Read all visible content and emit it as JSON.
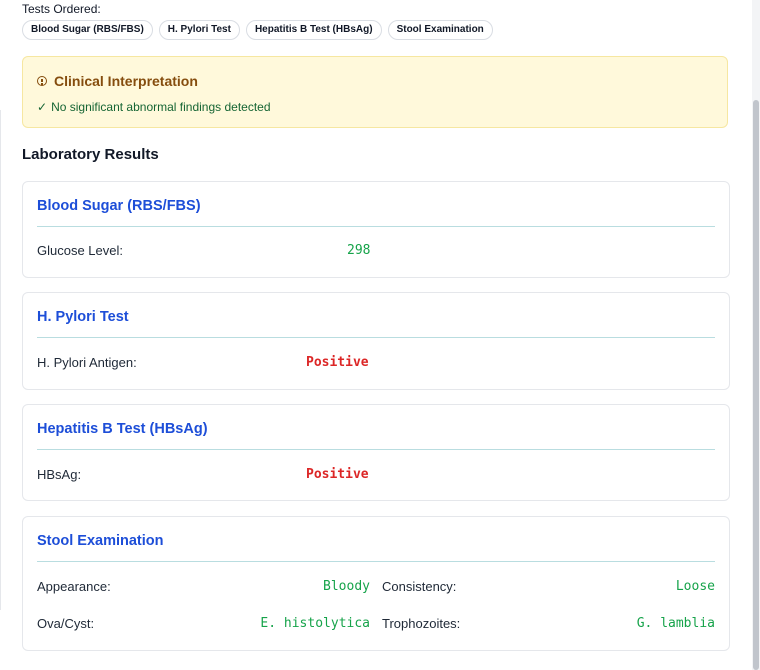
{
  "tests_ordered": {
    "label": "Tests Ordered:",
    "chips": [
      "Blood Sugar (RBS/FBS)",
      "H. Pylori Test",
      "Hepatitis B Test (HBsAg)",
      "Stool Examination"
    ]
  },
  "interpretation": {
    "title": "Clinical Interpretation",
    "check": "✓",
    "message": "No significant abnormal findings detected"
  },
  "results": {
    "title": "Laboratory Results",
    "blood_sugar": {
      "title": "Blood Sugar (RBS/FBS)",
      "label": "Glucose Level:",
      "value": "298"
    },
    "h_pylori": {
      "title": "H. Pylori Test",
      "label": "H. Pylori Antigen:",
      "value": "Positive"
    },
    "hep_b": {
      "title": "Hepatitis B Test (HBsAg)",
      "label": "HBsAg:",
      "value": "Positive"
    },
    "stool": {
      "title": "Stool Examination",
      "appearance_label": "Appearance:",
      "appearance_value": "Bloody",
      "consistency_label": "Consistency:",
      "consistency_value": "Loose",
      "ova_label": "Ova/Cyst:",
      "ova_value": "E. histolytica",
      "tropho_label": "Trophozoites:",
      "tropho_value": "G. lamblia"
    }
  },
  "colors": {
    "accent_blue": "#1d4ed8",
    "normal_green": "#16a34a",
    "abnormal_red": "#dc2626",
    "warning_bg": "#fff9db"
  }
}
